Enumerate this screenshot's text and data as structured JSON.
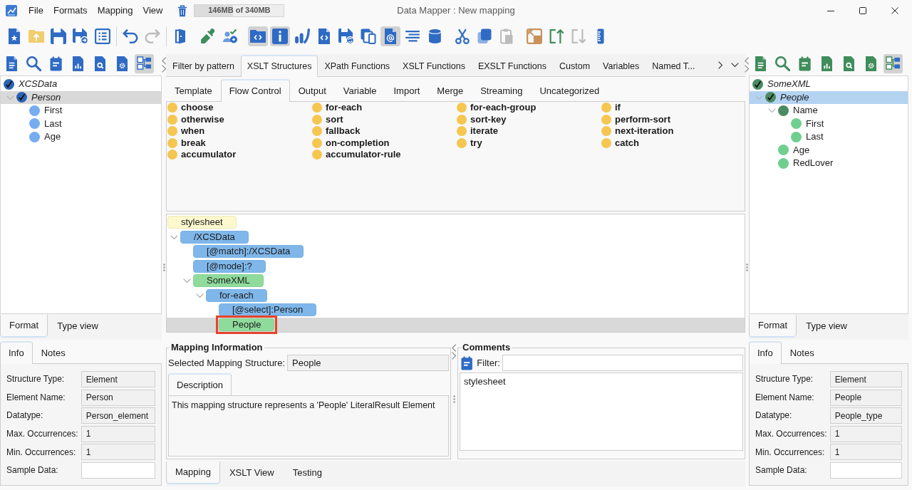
{
  "title_bar": {
    "menus": [
      "File",
      "Formats",
      "Mapping",
      "View"
    ],
    "memory": {
      "reading": "146MB of 340MB",
      "level": 0.43
    },
    "title": "Data Mapper : New mapping"
  },
  "toolbar": {
    "groups": [
      {
        "divider": false,
        "buttons": [
          {
            "pressed": false,
            "disabled": false
          },
          {
            "pressed": false,
            "disabled": false
          },
          {
            "pressed": false,
            "disabled": false
          },
          {
            "pressed": false,
            "disabled": false
          },
          {
            "pressed": false,
            "disabled": false
          }
        ]
      },
      {
        "divider": true,
        "buttons": [
          {
            "pressed": false,
            "disabled": false
          },
          {
            "pressed": false,
            "disabled": true
          }
        ]
      },
      {
        "divider": true,
        "buttons": [
          {
            "pressed": false,
            "disabled": false
          }
        ]
      },
      {
        "divider": false,
        "buttons": [
          {
            "pressed": false,
            "disabled": false
          },
          {
            "pressed": false,
            "disabled": false
          }
        ]
      },
      {
        "divider": false,
        "buttons": [
          {
            "pressed": true,
            "disabled": false
          },
          {
            "pressed": true,
            "disabled": false
          },
          {
            "pressed": false,
            "disabled": false
          },
          {
            "pressed": false,
            "disabled": false
          },
          {
            "pressed": false,
            "disabled": false
          },
          {
            "pressed": false,
            "disabled": false
          },
          {
            "pressed": true,
            "disabled": false
          },
          {
            "pressed": false,
            "disabled": false
          },
          {
            "pressed": false,
            "disabled": false
          }
        ]
      },
      {
        "divider": false,
        "buttons": [
          {
            "pressed": false,
            "disabled": false
          },
          {
            "pressed": false,
            "disabled": false
          },
          {
            "pressed": false,
            "disabled": true
          }
        ]
      },
      {
        "divider": false,
        "buttons": [
          {
            "pressed": false,
            "disabled": false
          },
          {
            "pressed": false,
            "disabled": false
          },
          {
            "pressed": false,
            "disabled": true
          },
          {
            "pressed": false,
            "disabled": false
          }
        ]
      }
    ]
  },
  "source_panel": {
    "focused": false,
    "tools": [
      {
        "pressed": false
      },
      {
        "pressed": false
      },
      {
        "pressed": false
      },
      {
        "pressed": false
      },
      {
        "pressed": false
      },
      {
        "pressed": false
      },
      {
        "pressed": true
      }
    ],
    "tree": {
      "label": "XCSData",
      "kind": "complex",
      "checked": true,
      "selected": false,
      "children": [
        {
          "label": "Person",
          "kind": "complex",
          "checked": true,
          "selected": true,
          "expanded": true,
          "children": [
            {
              "label": "First",
              "kind": "simple",
              "checked": false,
              "selected": false
            },
            {
              "label": "Last",
              "kind": "simple",
              "checked": false,
              "selected": false
            },
            {
              "label": "Age",
              "kind": "simple",
              "checked": false,
              "selected": false
            }
          ]
        }
      ]
    },
    "tabs": [
      {
        "label": "Format",
        "selected": true
      },
      {
        "label": "Type view",
        "selected": false
      }
    ],
    "info_tabs": [
      {
        "label": "Info",
        "selected": true
      },
      {
        "label": "Notes",
        "selected": false
      }
    ],
    "fields": [
      {
        "label": "Structure Type:",
        "value": "Element",
        "readonly": true
      },
      {
        "label": "Element Name:",
        "value": "Person",
        "readonly": true
      },
      {
        "label": "Datatype:",
        "value": "Person_element",
        "readonly": true
      },
      {
        "label": "Max. Occurrences:",
        "value": "1",
        "readonly": true
      },
      {
        "label": "Min. Occurrences:",
        "value": "1",
        "readonly": true
      },
      {
        "label": "Sample Data:",
        "readonly": false
      }
    ]
  },
  "workspace": {
    "library_tabs": [
      {
        "label": "Filter by pattern",
        "selected": false
      },
      {
        "label": "XSLT Structures",
        "selected": true
      },
      {
        "label": "XPath Functions",
        "selected": false
      },
      {
        "label": "XSLT Functions",
        "selected": false
      },
      {
        "label": "EXSLT Functions",
        "selected": false
      },
      {
        "label": "Custom",
        "selected": false
      },
      {
        "label": "Variables",
        "selected": false
      },
      {
        "label": "Named T...",
        "selected": false
      }
    ],
    "category_tabs": [
      {
        "label": "Template",
        "selected": false
      },
      {
        "label": "Flow Control",
        "selected": true
      },
      {
        "label": "Output",
        "selected": false
      },
      {
        "label": "Variable",
        "selected": false
      },
      {
        "label": "Import",
        "selected": false
      },
      {
        "label": "Merge",
        "selected": false
      },
      {
        "label": "Streaming",
        "selected": false
      },
      {
        "label": "Uncategorized",
        "selected": false
      }
    ],
    "structures": [
      "choose",
      "for-each",
      "for-each-group",
      "if",
      "otherwise",
      "sort",
      "sort-key",
      "perform-sort",
      "when",
      "fallback",
      "iterate",
      "next-iteration",
      "break",
      "on-completion",
      "try",
      "catch",
      "accumulator",
      "accumulator-rule"
    ],
    "mapping_tree": {
      "label": "stylesheet",
      "kind": "root",
      "selected": false,
      "outlined": false,
      "children": [
        {
          "label": "/XCSData",
          "kind": "xslt",
          "selected": false,
          "outlined": false,
          "expanded": true,
          "children": [
            {
              "label": "[@match]:/XCSData",
              "kind": "xslt",
              "selected": false,
              "outlined": false
            },
            {
              "label": "[@mode]:?",
              "kind": "xslt",
              "selected": false,
              "outlined": false
            },
            {
              "label": "SomeXML",
              "kind": "literal",
              "selected": false,
              "outlined": false,
              "expanded": true,
              "children": [
                {
                  "label": "for-each",
                  "kind": "xslt",
                  "selected": false,
                  "outlined": false,
                  "expanded": true,
                  "children": [
                    {
                      "label": "[@select]:Person",
                      "kind": "xslt",
                      "selected": false,
                      "outlined": false
                    },
                    {
                      "label": "People",
                      "kind": "literal",
                      "selected": true,
                      "outlined": true
                    }
                  ]
                }
              ]
            }
          ]
        }
      ]
    },
    "mapping_info": {
      "title": "Mapping Information",
      "structure_label": "Selected Mapping Structure:",
      "structure_value": "People",
      "tabs": [
        {
          "label": "Description",
          "selected": true
        }
      ],
      "description": "This mapping structure represents a 'People' LiteralResult Element"
    },
    "comments": {
      "title": "Comments",
      "filter_label": "Filter:",
      "entries": [
        "stylesheet"
      ]
    },
    "view_tabs": [
      {
        "label": "Mapping",
        "selected": true
      },
      {
        "label": "XSLT View",
        "selected": false
      },
      {
        "label": "Testing",
        "selected": false
      }
    ]
  },
  "target_panel": {
    "focused": true,
    "tools": [
      {
        "pressed": false
      },
      {
        "pressed": false
      },
      {
        "pressed": false
      },
      {
        "pressed": false
      },
      {
        "pressed": false
      },
      {
        "pressed": false
      },
      {
        "pressed": true
      }
    ],
    "tree": {
      "label": "SomeXML",
      "kind": "complex",
      "checked": true,
      "selected": false,
      "children": [
        {
          "label": "People",
          "kind": "complex",
          "checked": true,
          "selected": true,
          "expanded": true,
          "children": [
            {
              "label": "Name",
              "kind": "complex",
              "checked": false,
              "selected": false,
              "expanded": true,
              "children": [
                {
                  "label": "First",
                  "kind": "simple",
                  "checked": false,
                  "selected": false
                },
                {
                  "label": "Last",
                  "kind": "simple",
                  "checked": false,
                  "selected": false
                }
              ]
            },
            {
              "label": "Age",
              "kind": "simple",
              "checked": false,
              "selected": false
            },
            {
              "label": "RedLover",
              "kind": "simple",
              "checked": false,
              "selected": false
            }
          ]
        }
      ]
    },
    "tabs": [
      {
        "label": "Format",
        "selected": true
      },
      {
        "label": "Type view",
        "selected": false
      }
    ],
    "info_tabs": [
      {
        "label": "Info",
        "selected": true
      },
      {
        "label": "Notes",
        "selected": false
      }
    ],
    "fields": [
      {
        "label": "Structure Type:",
        "value": "Element",
        "readonly": true
      },
      {
        "label": "Element Name:",
        "value": "People",
        "readonly": true
      },
      {
        "label": "Datatype:",
        "value": "People_type",
        "readonly": true
      },
      {
        "label": "Max. Occurrences:",
        "value": "1",
        "readonly": true
      },
      {
        "label": "Min. Occurrences:",
        "value": "1",
        "readonly": true
      },
      {
        "label": "Sample Data:",
        "readonly": false
      }
    ]
  }
}
